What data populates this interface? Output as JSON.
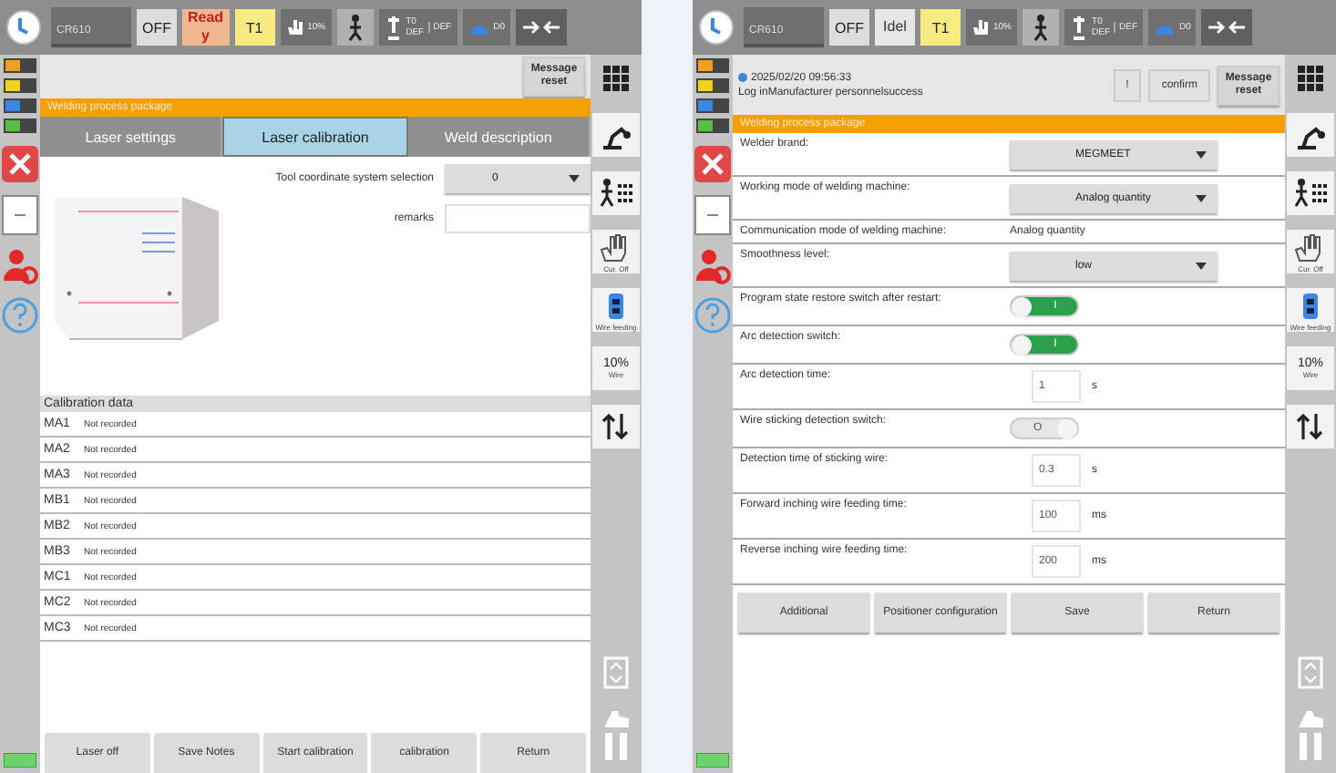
{
  "panels": [
    {
      "status_bar": {
        "controller": "CR610",
        "servo": "OFF",
        "state": {
          "lines": [
            "Read",
            "y"
          ],
          "kind": "ready"
        },
        "mode": "T1",
        "speed": "10%",
        "tool": [
          "T0",
          "DEF"
        ],
        "user_frame": "DEF",
        "output": "D0"
      },
      "indicators": [
        {
          "color": "#f0a020"
        },
        {
          "color": "#f0d020"
        },
        {
          "color": "#3b86e0"
        },
        {
          "color": "#58c040"
        }
      ],
      "header": {
        "buttons": [
          "Message reset"
        ]
      },
      "banner": "Welding process package",
      "tools": [
        {
          "kind": "robot"
        },
        {
          "kind": "jog"
        },
        {
          "kind": "hand",
          "caption": "Cur. Off"
        },
        {
          "kind": "wirefeed",
          "caption": "Wire feeding"
        },
        {
          "kind": "speed",
          "value": "10%",
          "caption": "Wire"
        },
        {
          "kind": "swap"
        }
      ],
      "content": {
        "kind": "calibration",
        "tabs": [
          {
            "label": "Laser settings",
            "selected": false
          },
          {
            "label": "Laser calibration",
            "selected": true
          },
          {
            "label": "Weld description",
            "selected": false
          }
        ],
        "tool_select": {
          "label": "Tool coordinate system selection",
          "value": "0"
        },
        "remarks": {
          "label": "remarks"
        },
        "data_title": "Calibration data",
        "rows": [
          {
            "name": "MA1",
            "status": "Not recorded"
          },
          {
            "name": "MA2",
            "status": "Not recorded"
          },
          {
            "name": "MA3",
            "status": "Not recorded"
          },
          {
            "name": "MB1",
            "status": "Not recorded"
          },
          {
            "name": "MB2",
            "status": "Not recorded"
          },
          {
            "name": "MB3",
            "status": "Not recorded"
          },
          {
            "name": "MC1",
            "status": "Not recorded"
          },
          {
            "name": "MC2",
            "status": "Not recorded"
          },
          {
            "name": "MC3",
            "status": "Not recorded"
          }
        ],
        "buttons": [
          "Laser off",
          "Save Notes",
          "Start calibration",
          "calibration",
          "Return"
        ]
      }
    },
    {
      "status_bar": {
        "controller": "CR610",
        "servo": "OFF",
        "state": {
          "lines": [
            "Idel"
          ],
          "kind": "idle"
        },
        "mode": "T1",
        "speed": "10%",
        "tool": [
          "T0",
          "DEF"
        ],
        "user_frame": "DEF",
        "output": "D0"
      },
      "indicators": [
        {
          "color": "#f0a020"
        },
        {
          "color": "#f0d020"
        },
        {
          "color": "#3b86e0"
        },
        {
          "color": "#58c040"
        }
      ],
      "header": {
        "log": {
          "time": "2025/02/20 09:56:33",
          "message": "Log inManufacturer personnelsuccess"
        },
        "buttons": [
          "!",
          "confirm",
          "Message reset"
        ]
      },
      "banner": "Welding process package",
      "tools": [
        {
          "kind": "robot"
        },
        {
          "kind": "jog"
        },
        {
          "kind": "hand",
          "caption": "Cur. Off"
        },
        {
          "kind": "wirefeed",
          "caption": "Wire feeding"
        },
        {
          "kind": "speed",
          "value": "10%",
          "caption": "Wire"
        },
        {
          "kind": "swap"
        }
      ],
      "content": {
        "kind": "settings",
        "rows": [
          {
            "kind": "dropdown",
            "label": "Welder brand:",
            "value": "MEGMEET"
          },
          {
            "kind": "dropdown",
            "label": "Working mode of welding machine:",
            "value": "Analog quantity"
          },
          {
            "kind": "text",
            "label": "Communication mode of welding machine:",
            "value": "Analog quantity"
          },
          {
            "kind": "dropdown",
            "label": "Smoothness level:",
            "value": "low"
          },
          {
            "kind": "switch",
            "label": "Program state restore switch after restart:",
            "on": true,
            "text": "I"
          },
          {
            "kind": "switch",
            "label": "Arc detection switch:",
            "on": true,
            "text": "I"
          },
          {
            "kind": "number",
            "label": "Arc detection time:",
            "value": "1",
            "unit": "s"
          },
          {
            "kind": "switch",
            "label": "Wire sticking detection switch:",
            "on": false,
            "text": "O"
          },
          {
            "kind": "number",
            "label": "Detection time of sticking wire:",
            "value": "0.3",
            "unit": "s"
          },
          {
            "kind": "number",
            "label": "Forward inching wire feeding time:",
            "value": "100",
            "unit": "ms"
          },
          {
            "kind": "number",
            "label": "Reverse inching wire feeding time:",
            "value": "200",
            "unit": "ms"
          }
        ],
        "buttons": [
          "Additional",
          "Positioner configuration",
          "Save",
          "Return"
        ]
      }
    }
  ]
}
